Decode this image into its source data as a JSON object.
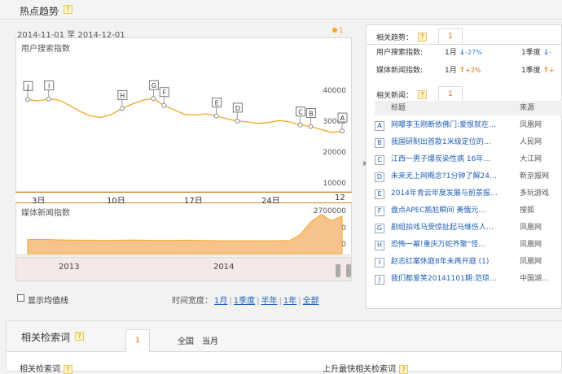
{
  "header": {
    "title": "热点趋势",
    "help": "?"
  },
  "chart": {
    "date_range": "2014-11-01 至 2014-12-01",
    "legend_number": "1",
    "search_label": "用户搜索指数",
    "media_label": "媒体新闻指数",
    "search_ticks": [
      "40000",
      "30000",
      "20000",
      "10000"
    ],
    "media_ticks": [
      "2700000",
      "1800000",
      "900000"
    ],
    "x_ticks": [
      "3日",
      "10日",
      "17日",
      "24日",
      "12月"
    ],
    "years": [
      "2013",
      "2014"
    ],
    "markers": [
      "J",
      "I",
      "H",
      "G",
      "F",
      "E",
      "D",
      "C",
      "B",
      "A"
    ],
    "colors": {
      "line": "#f5a623",
      "accent": "#e06b00",
      "link": "#1f5fb5"
    }
  },
  "chart_data": {
    "type": "line",
    "x_axis": "date",
    "x": [
      "2014-11-01",
      "2014-11-02",
      "2014-11-03",
      "2014-11-04",
      "2014-11-05",
      "2014-11-06",
      "2014-11-07",
      "2014-11-08",
      "2014-11-09",
      "2014-11-10",
      "2014-11-11",
      "2014-11-12",
      "2014-11-13",
      "2014-11-14",
      "2014-11-15",
      "2014-11-16",
      "2014-11-17",
      "2014-11-18",
      "2014-11-19",
      "2014-11-20",
      "2014-11-21",
      "2014-11-22",
      "2014-11-23",
      "2014-11-24",
      "2014-11-25",
      "2014-11-26",
      "2014-11-27",
      "2014-11-28",
      "2014-11-29",
      "2014-11-30",
      "2014-12-01"
    ],
    "series": [
      {
        "values": [
          30000,
          29500,
          30200,
          29800,
          28000,
          26000,
          24500,
          24000,
          25000,
          27000,
          28500,
          29800,
          30300,
          28000,
          26500,
          25000,
          24800,
          25200,
          24500,
          23500,
          22800,
          22500,
          22000,
          22300,
          23000,
          22500,
          21500,
          21000,
          20000,
          19000,
          19500
        ]
      }
    ],
    "ylim": [
      0,
      45000
    ],
    "media_series": [
      900000,
      905000,
      900000,
      880000,
      870000,
      860000,
      860000,
      850000,
      850000,
      860000,
      870000,
      860000,
      850000,
      850000,
      850000,
      860000,
      850000,
      840000,
      830000,
      820000,
      820000,
      830000,
      820000,
      820000,
      830000,
      840000,
      1200000,
      2000000,
      2500000,
      2100000,
      2400000
    ],
    "media_ylim": [
      0,
      3000000
    ],
    "grid": false
  },
  "controls": {
    "show_avg": "显示均值线",
    "time_span_label": "时间宽度：",
    "spans": [
      "1月",
      "1季度",
      "半年",
      "1年",
      "全部"
    ]
  },
  "right": {
    "trend_label": "相关趋势：",
    "tab_1": "1",
    "rows": [
      {
        "label": "用户搜索指数:",
        "period1": "1月",
        "dir1": "↓",
        "pct1": "-27%",
        "period2": "1季度",
        "dir2": "↓"
      },
      {
        "label": "媒体新闻指数:",
        "period1": "1月",
        "dir1": "↑",
        "pct1": "+2%",
        "period2": "1季度",
        "dir2": "↑"
      }
    ],
    "news_label": "相关新闻：",
    "news_tab": "1",
    "col_title": "标题",
    "col_source": "来源",
    "news": [
      {
        "letter": "A",
        "title": "网曝李玉刚断依佛门:爱恨就在…",
        "source": "凤凰网"
      },
      {
        "letter": "B",
        "title": "我国研制出首款1米级定位的…",
        "source": "人民网"
      },
      {
        "letter": "C",
        "title": "江西一男子爆炭染性病 16年…",
        "source": "大江网"
      },
      {
        "letter": "D",
        "title": "未来无上网概念?1分钟了解24…",
        "source": "新京报网"
      },
      {
        "letter": "E",
        "title": "2014年青云年度发展与前景报…",
        "source": "多玩游戏"
      },
      {
        "letter": "F",
        "title": "盘点APEC尴尬瞬间 美俄元…",
        "source": "搜狐"
      },
      {
        "letter": "G",
        "title": "剧组拍戏马受惊扯起马维伤人…",
        "source": "凤凰网"
      },
      {
        "letter": "H",
        "title": "恐怖一幕!重庆万蛇齐聚“怪…",
        "source": "凤凰网"
      },
      {
        "letter": "I",
        "title": "赵志红案休庭8年未再开庭 (1)",
        "source": "凤凰网"
      },
      {
        "letter": "J",
        "title": "我们都爱笑20141101期:范琼…",
        "source": "中国湖…"
      }
    ]
  },
  "related": {
    "title": "相关检索词",
    "tab": "1",
    "filter_all": "全国",
    "filter_month": "当月",
    "col_related": "相关检索词",
    "col_rising": "上升最快相关检索词"
  }
}
